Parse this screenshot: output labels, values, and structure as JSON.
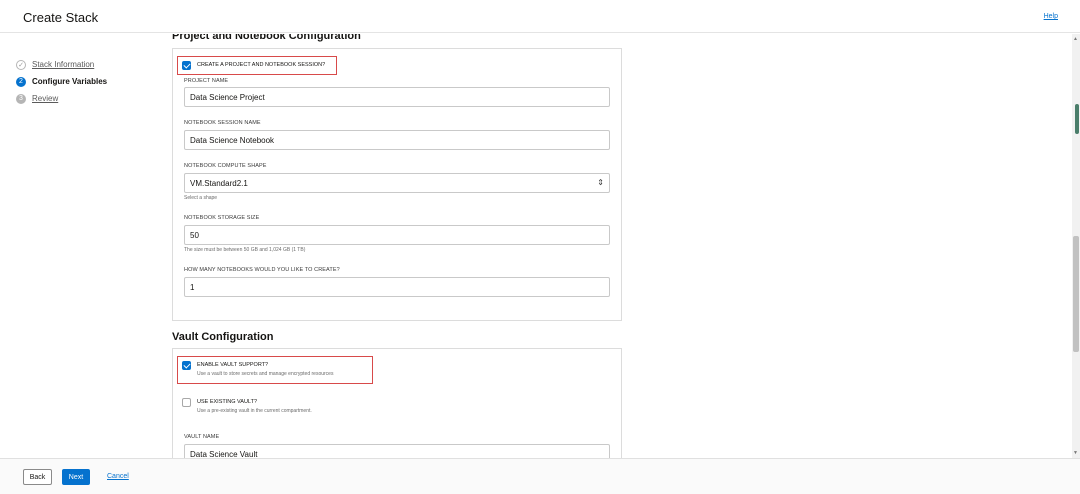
{
  "header": {
    "title": "Create Stack",
    "help": "Help"
  },
  "steps": [
    {
      "number": "✓",
      "label": "Stack Information",
      "state": "done"
    },
    {
      "number": "2",
      "label": "Configure Variables",
      "state": "active"
    },
    {
      "number": "3",
      "label": "Review",
      "state": "pending"
    }
  ],
  "project_section": {
    "heading": "Project and Notebook Configuration",
    "create_checkbox": {
      "label": "CREATE A PROJECT AND NOTEBOOK SESSION?",
      "checked": true
    },
    "project_name": {
      "label": "PROJECT NAME",
      "value": "Data Science Project"
    },
    "notebook_session_name": {
      "label": "NOTEBOOK SESSION NAME",
      "value": "Data Science Notebook"
    },
    "compute_shape": {
      "label": "NOTEBOOK COMPUTE SHAPE",
      "value": "VM.Standard2.1",
      "hint": "Select a shape"
    },
    "storage_size": {
      "label": "NOTEBOOK STORAGE SIZE",
      "value": "50",
      "hint": "The size must be between 50 GB and 1,024 GB (1 TB)"
    },
    "notebook_count": {
      "label": "HOW MANY NOTEBOOKS WOULD YOU LIKE TO CREATE?",
      "value": "1"
    }
  },
  "vault_section": {
    "heading": "Vault Configuration",
    "enable_vault": {
      "label": "ENABLE VAULT SUPPORT?",
      "sub": "Use a vault to store secrets and manage encrypted resources",
      "checked": true
    },
    "use_existing": {
      "label": "USE EXISTING VAULT?",
      "sub": "Use a pre-existing vault in the current compartment.",
      "checked": false
    },
    "vault_name": {
      "label": "VAULT NAME",
      "value": "Data Science Vault"
    }
  },
  "footer": {
    "back": "Back",
    "next": "Next",
    "cancel": "Cancel"
  },
  "colors": {
    "accent": "#0572ce",
    "highlight": "#d84a4a"
  }
}
